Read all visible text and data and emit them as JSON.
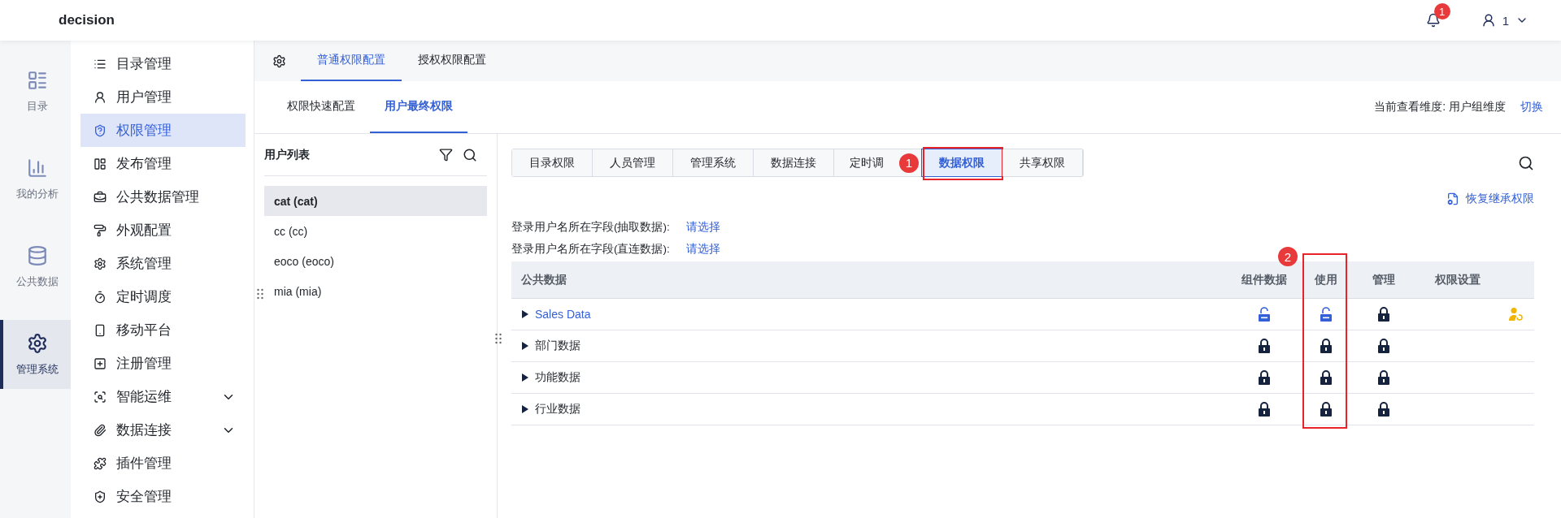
{
  "header": {
    "title": "decision",
    "notifications": "1",
    "user": "1"
  },
  "rail": [
    {
      "label": "目录",
      "selected": false
    },
    {
      "label": "我的分析",
      "selected": false
    },
    {
      "label": "公共数据",
      "selected": false
    },
    {
      "label": "管理系统",
      "selected": true
    }
  ],
  "menu": [
    {
      "label": "目录管理",
      "selected": false,
      "expandable": false
    },
    {
      "label": "用户管理",
      "selected": false,
      "expandable": false
    },
    {
      "label": "权限管理",
      "selected": true,
      "expandable": false
    },
    {
      "label": "发布管理",
      "selected": false,
      "expandable": false
    },
    {
      "label": "公共数据管理",
      "selected": false,
      "expandable": false
    },
    {
      "label": "外观配置",
      "selected": false,
      "expandable": false
    },
    {
      "label": "系统管理",
      "selected": false,
      "expandable": false
    },
    {
      "label": "定时调度",
      "selected": false,
      "expandable": false
    },
    {
      "label": "移动平台",
      "selected": false,
      "expandable": false
    },
    {
      "label": "注册管理",
      "selected": false,
      "expandable": false
    },
    {
      "label": "智能运维",
      "selected": false,
      "expandable": true
    },
    {
      "label": "数据连接",
      "selected": false,
      "expandable": true
    },
    {
      "label": "插件管理",
      "selected": false,
      "expandable": false
    },
    {
      "label": "安全管理",
      "selected": false,
      "expandable": false
    }
  ],
  "top_tabs": [
    {
      "label": "普通权限配置",
      "selected": true
    },
    {
      "label": "授权权限配置",
      "selected": false
    }
  ],
  "sub_tabs": [
    {
      "label": "权限快速配置",
      "selected": false
    },
    {
      "label": "用户最终权限",
      "selected": true
    }
  ],
  "dimension": {
    "label": "当前查看维度: 用户组维度",
    "link": "切换"
  },
  "user_list": {
    "title": "用户列表",
    "users": [
      {
        "name": "cat (cat)",
        "selected": true
      },
      {
        "name": "cc (cc)",
        "selected": false
      },
      {
        "name": "eoco (eoco)",
        "selected": false
      },
      {
        "name": "mia (mia)",
        "selected": false
      }
    ]
  },
  "permission_tabs": [
    {
      "label": "目录权限",
      "selected": false,
      "boxed": false
    },
    {
      "label": "人员管理",
      "selected": false,
      "boxed": false
    },
    {
      "label": "管理系统",
      "selected": false,
      "boxed": false
    },
    {
      "label": "数据连接",
      "selected": false,
      "boxed": false
    },
    {
      "label": "定时调",
      "selected": false,
      "badge": "1",
      "boxed": false
    },
    {
      "label": "数据权限",
      "selected": true,
      "boxed": true
    },
    {
      "label": "共享权限",
      "selected": false,
      "boxed": false
    }
  ],
  "restore_link": "恢复继承权限",
  "fields": [
    {
      "label": "登录用户名所在字段(抽取数据):",
      "value": "请选择"
    },
    {
      "label": "登录用户名所在字段(直连数据):",
      "value": "请选择"
    }
  ],
  "table": {
    "columns": [
      {
        "label": "公共数据",
        "boxed": false
      },
      {
        "label": "组件数据",
        "badge": "2",
        "boxed": false
      },
      {
        "label": "使用",
        "boxed": true
      },
      {
        "label": "管理",
        "boxed": false
      },
      {
        "label": "权限设置",
        "boxed": false
      }
    ],
    "rows": [
      {
        "name": "Sales Data",
        "highlighted": true,
        "component_locked": false,
        "use_locked": false,
        "manage_locked": true,
        "inherit_reset": true
      },
      {
        "name": "部门数据",
        "highlighted": false,
        "component_locked": true,
        "use_locked": true,
        "manage_locked": true,
        "inherit_reset": false
      },
      {
        "name": "功能数据",
        "highlighted": false,
        "component_locked": true,
        "use_locked": true,
        "manage_locked": true,
        "inherit_reset": false
      },
      {
        "name": "行业数据",
        "highlighted": false,
        "component_locked": true,
        "use_locked": true,
        "manage_locked": true,
        "inherit_reset": false
      }
    ]
  }
}
